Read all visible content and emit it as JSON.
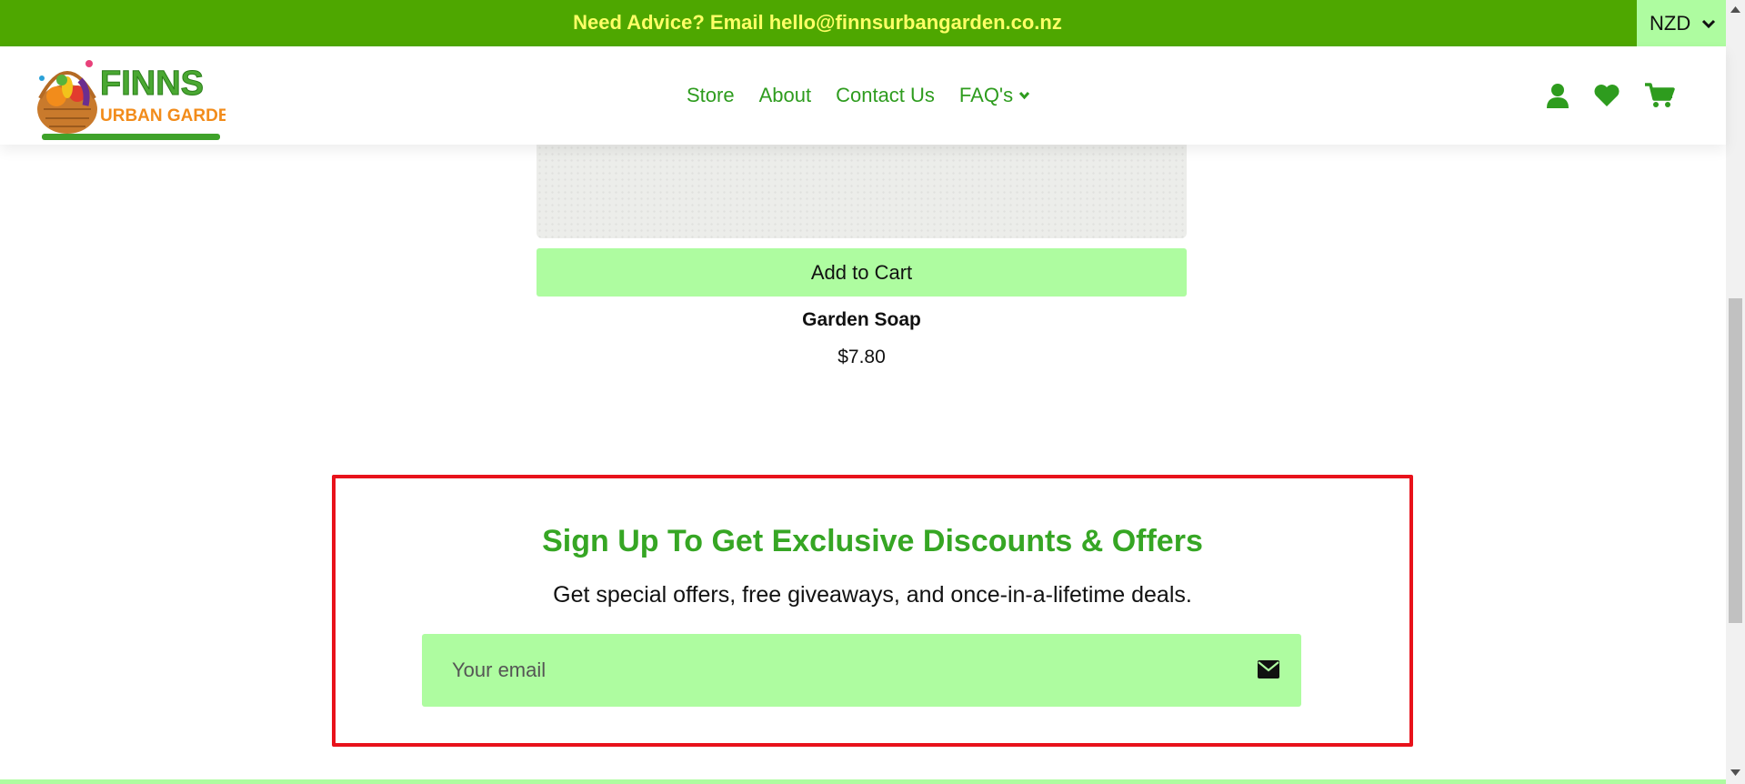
{
  "topbar": {
    "message": "Need Advice? Email hello@finnsurbangarden.co.nz",
    "currency": "NZD"
  },
  "header": {
    "logo_text_top": "FINNS",
    "logo_text_bottom": "URBAN GARDEN",
    "nav": [
      {
        "label": "Store"
      },
      {
        "label": "About"
      },
      {
        "label": "Contact Us"
      },
      {
        "label": "FAQ's"
      }
    ]
  },
  "product": {
    "add_to_cart_label": "Add to Cart",
    "name": "Garden Soap",
    "price": "$7.80"
  },
  "signup": {
    "title": "Sign Up To Get Exclusive Discounts & Offers",
    "subtitle": "Get special offers, free giveaways, and once-in-a-lifetime deals.",
    "email_placeholder": "Your email"
  },
  "colors": {
    "brand_green": "#4ea700",
    "text_green": "#2e9c1e",
    "light_green": "#aefca0",
    "highlight_red": "#e8121b",
    "topbar_text": "#ffff66"
  }
}
